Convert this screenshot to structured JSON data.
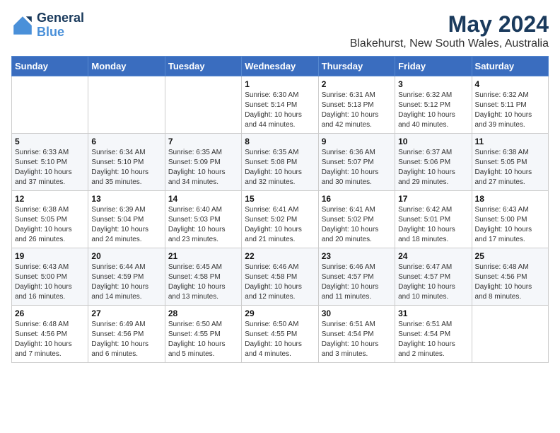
{
  "header": {
    "logo_line1": "General",
    "logo_line2": "Blue",
    "month_year": "May 2024",
    "location": "Blakehurst, New South Wales, Australia"
  },
  "days_of_week": [
    "Sunday",
    "Monday",
    "Tuesday",
    "Wednesday",
    "Thursday",
    "Friday",
    "Saturday"
  ],
  "weeks": [
    [
      {
        "day": "",
        "info": ""
      },
      {
        "day": "",
        "info": ""
      },
      {
        "day": "",
        "info": ""
      },
      {
        "day": "1",
        "info": "Sunrise: 6:30 AM\nSunset: 5:14 PM\nDaylight: 10 hours\nand 44 minutes."
      },
      {
        "day": "2",
        "info": "Sunrise: 6:31 AM\nSunset: 5:13 PM\nDaylight: 10 hours\nand 42 minutes."
      },
      {
        "day": "3",
        "info": "Sunrise: 6:32 AM\nSunset: 5:12 PM\nDaylight: 10 hours\nand 40 minutes."
      },
      {
        "day": "4",
        "info": "Sunrise: 6:32 AM\nSunset: 5:11 PM\nDaylight: 10 hours\nand 39 minutes."
      }
    ],
    [
      {
        "day": "5",
        "info": "Sunrise: 6:33 AM\nSunset: 5:10 PM\nDaylight: 10 hours\nand 37 minutes."
      },
      {
        "day": "6",
        "info": "Sunrise: 6:34 AM\nSunset: 5:10 PM\nDaylight: 10 hours\nand 35 minutes."
      },
      {
        "day": "7",
        "info": "Sunrise: 6:35 AM\nSunset: 5:09 PM\nDaylight: 10 hours\nand 34 minutes."
      },
      {
        "day": "8",
        "info": "Sunrise: 6:35 AM\nSunset: 5:08 PM\nDaylight: 10 hours\nand 32 minutes."
      },
      {
        "day": "9",
        "info": "Sunrise: 6:36 AM\nSunset: 5:07 PM\nDaylight: 10 hours\nand 30 minutes."
      },
      {
        "day": "10",
        "info": "Sunrise: 6:37 AM\nSunset: 5:06 PM\nDaylight: 10 hours\nand 29 minutes."
      },
      {
        "day": "11",
        "info": "Sunrise: 6:38 AM\nSunset: 5:05 PM\nDaylight: 10 hours\nand 27 minutes."
      }
    ],
    [
      {
        "day": "12",
        "info": "Sunrise: 6:38 AM\nSunset: 5:05 PM\nDaylight: 10 hours\nand 26 minutes."
      },
      {
        "day": "13",
        "info": "Sunrise: 6:39 AM\nSunset: 5:04 PM\nDaylight: 10 hours\nand 24 minutes."
      },
      {
        "day": "14",
        "info": "Sunrise: 6:40 AM\nSunset: 5:03 PM\nDaylight: 10 hours\nand 23 minutes."
      },
      {
        "day": "15",
        "info": "Sunrise: 6:41 AM\nSunset: 5:02 PM\nDaylight: 10 hours\nand 21 minutes."
      },
      {
        "day": "16",
        "info": "Sunrise: 6:41 AM\nSunset: 5:02 PM\nDaylight: 10 hours\nand 20 minutes."
      },
      {
        "day": "17",
        "info": "Sunrise: 6:42 AM\nSunset: 5:01 PM\nDaylight: 10 hours\nand 18 minutes."
      },
      {
        "day": "18",
        "info": "Sunrise: 6:43 AM\nSunset: 5:00 PM\nDaylight: 10 hours\nand 17 minutes."
      }
    ],
    [
      {
        "day": "19",
        "info": "Sunrise: 6:43 AM\nSunset: 5:00 PM\nDaylight: 10 hours\nand 16 minutes."
      },
      {
        "day": "20",
        "info": "Sunrise: 6:44 AM\nSunset: 4:59 PM\nDaylight: 10 hours\nand 14 minutes."
      },
      {
        "day": "21",
        "info": "Sunrise: 6:45 AM\nSunset: 4:58 PM\nDaylight: 10 hours\nand 13 minutes."
      },
      {
        "day": "22",
        "info": "Sunrise: 6:46 AM\nSunset: 4:58 PM\nDaylight: 10 hours\nand 12 minutes."
      },
      {
        "day": "23",
        "info": "Sunrise: 6:46 AM\nSunset: 4:57 PM\nDaylight: 10 hours\nand 11 minutes."
      },
      {
        "day": "24",
        "info": "Sunrise: 6:47 AM\nSunset: 4:57 PM\nDaylight: 10 hours\nand 10 minutes."
      },
      {
        "day": "25",
        "info": "Sunrise: 6:48 AM\nSunset: 4:56 PM\nDaylight: 10 hours\nand 8 minutes."
      }
    ],
    [
      {
        "day": "26",
        "info": "Sunrise: 6:48 AM\nSunset: 4:56 PM\nDaylight: 10 hours\nand 7 minutes."
      },
      {
        "day": "27",
        "info": "Sunrise: 6:49 AM\nSunset: 4:56 PM\nDaylight: 10 hours\nand 6 minutes."
      },
      {
        "day": "28",
        "info": "Sunrise: 6:50 AM\nSunset: 4:55 PM\nDaylight: 10 hours\nand 5 minutes."
      },
      {
        "day": "29",
        "info": "Sunrise: 6:50 AM\nSunset: 4:55 PM\nDaylight: 10 hours\nand 4 minutes."
      },
      {
        "day": "30",
        "info": "Sunrise: 6:51 AM\nSunset: 4:54 PM\nDaylight: 10 hours\nand 3 minutes."
      },
      {
        "day": "31",
        "info": "Sunrise: 6:51 AM\nSunset: 4:54 PM\nDaylight: 10 hours\nand 2 minutes."
      },
      {
        "day": "",
        "info": ""
      }
    ]
  ]
}
